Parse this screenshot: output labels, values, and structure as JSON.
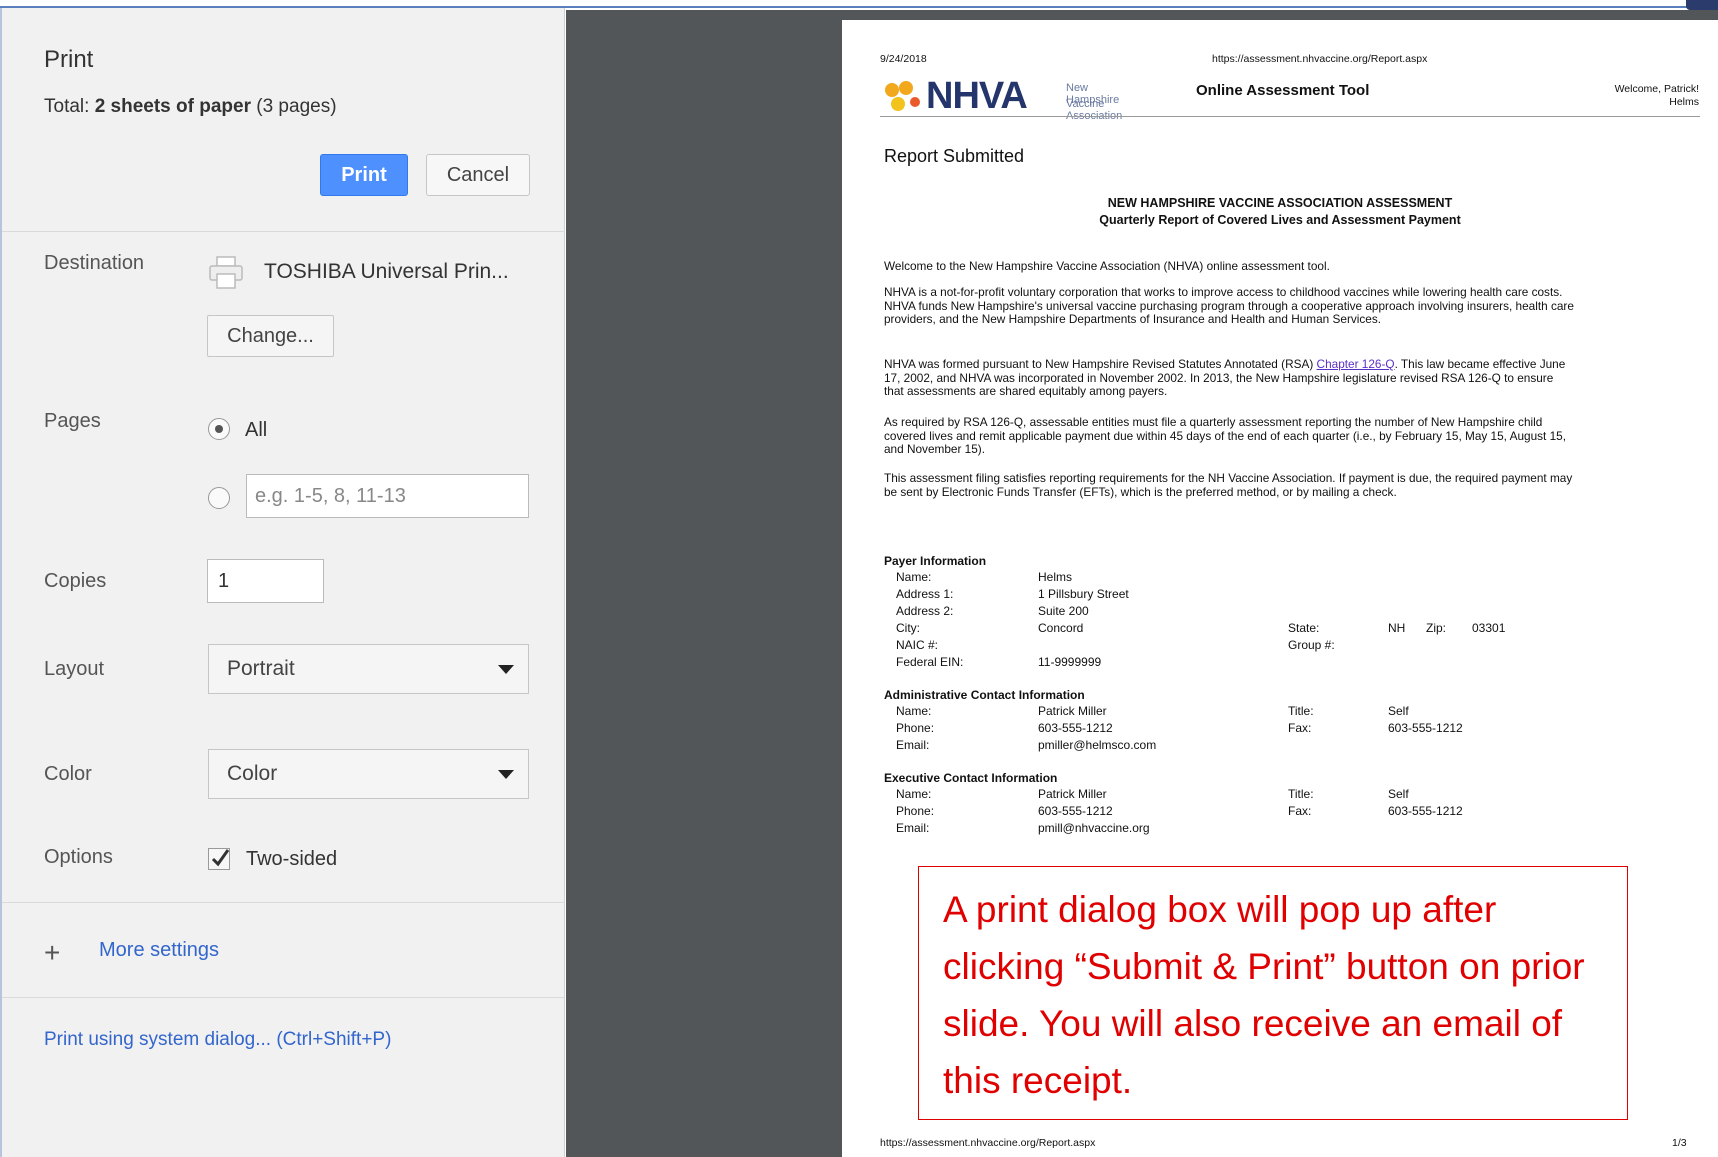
{
  "sidebar": {
    "title": "Print",
    "total_prefix": "Total: ",
    "total_bold": "2 sheets of paper",
    "total_suffix": " (3 pages)",
    "print_button": "Print",
    "cancel_button": "Cancel",
    "destination_label": "Destination",
    "destination_name": "TOSHIBA Universal Prin...",
    "change_button": "Change...",
    "pages_label": "Pages",
    "pages_all": "All",
    "pages_placeholder": "e.g. 1-5, 8, 11-13",
    "copies_label": "Copies",
    "copies_value": "1",
    "layout_label": "Layout",
    "layout_value": "Portrait",
    "color_label": "Color",
    "color_value": "Color",
    "options_label": "Options",
    "two_sided": "Two-sided",
    "more_settings": "More settings",
    "system_dialog": "Print using system dialog... (Ctrl+Shift+P)"
  },
  "preview": {
    "date": "9/24/2018",
    "url": "https://assessment.nhvaccine.org/Report.aspx",
    "logo_text": "NHVA",
    "logo_sub1": "New Hampshire",
    "logo_sub2": "Vaccine Association",
    "tool_title": "Online Assessment Tool",
    "welcome_line1": "Welcome, Patrick!",
    "welcome_line2": "Helms",
    "report_title": "Report Submitted",
    "heading1": "NEW HAMPSHIRE VACCINE ASSOCIATION ASSESSMENT",
    "heading2": "Quarterly Report of Covered Lives and Assessment Payment",
    "para1": "Welcome to the New Hampshire Vaccine Association (NHVA) online assessment tool.",
    "para2": "NHVA is a not-for-profit voluntary corporation that works to improve access to childhood vaccines while lowering health care costs. NHVA funds New Hampshire's universal vaccine purchasing program through a cooperative approach involving insurers, health care providers, and the New Hampshire Departments of Insurance and Health and Human Services.",
    "para3_before": "NHVA was formed pursuant to New Hampshire Revised Statutes Annotated (RSA) ",
    "para3_link": "Chapter 126-Q",
    "para3_after": ". This law became effective June 17, 2002, and NHVA was incorporated in November 2002. In 2013, the New Hampshire legislature revised RSA 126-Q to ensure that assessments are shared equitably among payers.",
    "para4": "As required by RSA 126-Q, assessable entities must file a quarterly assessment reporting the number of New Hampshire child covered lives and remit applicable payment due within 45 days of the end of each quarter (i.e., by February 15, May 15, August 15, and November 15).",
    "para5": "This assessment filing satisfies reporting requirements for the NH Vaccine Association. If payment is due, the required payment may be sent by Electronic Funds Transfer (EFTs), which is the preferred method, or by mailing a check.",
    "payer": {
      "heading": "Payer Information",
      "name_label": "Name:",
      "name": "Helms",
      "addr1_label": "Address 1:",
      "addr1": "1 Pillsbury Street",
      "addr2_label": "Address 2:",
      "addr2": "Suite 200",
      "city_label": "City:",
      "city": "Concord",
      "naic_label": "NAIC #:",
      "ein_label": "Federal EIN:",
      "ein": "11-9999999",
      "state_label": "State:",
      "state": "NH",
      "zip_label": "Zip:",
      "zip": "03301",
      "group_label": "Group #:"
    },
    "admin": {
      "heading": "Administrative Contact Information",
      "name_label": "Name:",
      "name": "Patrick Miller",
      "phone_label": "Phone:",
      "phone": "603-555-1212",
      "email_label": "Email:",
      "email": "pmiller@helmsco.com",
      "title_label": "Title:",
      "title": "Self",
      "fax_label": "Fax:",
      "fax": "603-555-1212"
    },
    "exec": {
      "heading": "Executive Contact Information",
      "name_label": "Name:",
      "name": "Patrick Miller",
      "phone_label": "Phone:",
      "phone": "603-555-1212",
      "email_label": "Email:",
      "email": "pmill@nhvaccine.org",
      "title_label": "Title:",
      "title": "Self",
      "fax_label": "Fax:",
      "fax": "603-555-1212"
    },
    "page_number": "1/3"
  },
  "callout": {
    "text": "A print dialog box will pop up after clicking “Submit & Print” button on prior slide.  You will also receive an email of this receipt."
  },
  "colors": {
    "print_button": "#4d90fe",
    "link": "#3366cc",
    "callout": "#e00000",
    "preview_bg": "#525659"
  }
}
